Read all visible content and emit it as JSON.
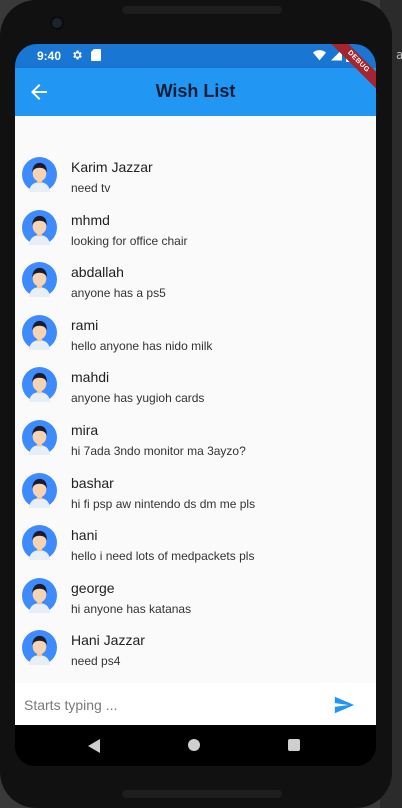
{
  "status_bar": {
    "time": "9:40"
  },
  "app_bar": {
    "title": "Wish List",
    "debug_banner": "DEBUG"
  },
  "ide": {
    "edge_char": "a"
  },
  "colors": {
    "status_bar": "#1976d2",
    "app_bar": "#2196f3",
    "title_text": "#0c1e35",
    "avatar_bg": "#3d8bfd",
    "send_icon": "#2196f3",
    "body_bg": "#fafafa"
  },
  "wishes": [
    {
      "name": "Karim Jazzar",
      "message": "need tv"
    },
    {
      "name": "mhmd",
      "message": "looking for office chair"
    },
    {
      "name": "abdallah",
      "message": "anyone has a ps5"
    },
    {
      "name": "rami",
      "message": "hello anyone has nido milk"
    },
    {
      "name": "mahdi",
      "message": "anyone has yugioh cards"
    },
    {
      "name": "mira",
      "message": "hi 7ada 3ndo monitor ma 3ayzo?"
    },
    {
      "name": "bashar",
      "message": "hi fi psp aw nintendo ds dm me pls"
    },
    {
      "name": "hani",
      "message": "hello i need lots of medpackets pls"
    },
    {
      "name": "george",
      "message": "hi anyone has katanas"
    },
    {
      "name": "Hani Jazzar",
      "message": "need ps4"
    }
  ],
  "composer": {
    "placeholder": "Starts typing ...",
    "value": ""
  },
  "icons": {
    "back": "arrow-back-icon",
    "send": "send-icon",
    "avatar": "user-avatar-icon",
    "settings": "gear-icon",
    "sd_card": "sd-card-icon",
    "wifi": "wifi-icon",
    "battery": "battery-icon",
    "nav_back": "triangle-back-icon",
    "nav_home": "circle-home-icon",
    "nav_recent": "square-recents-icon"
  }
}
